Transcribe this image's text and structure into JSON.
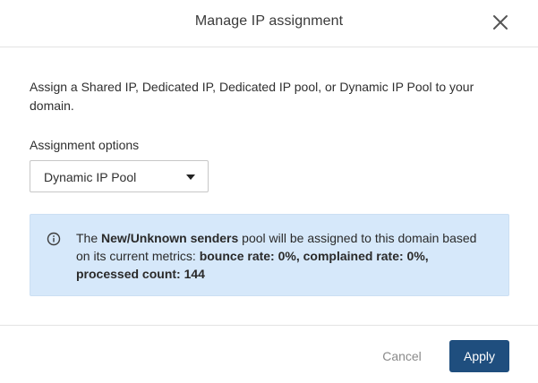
{
  "dialog": {
    "title": "Manage IP assignment",
    "close_icon": "close-icon"
  },
  "body": {
    "description": "Assign a Shared IP, Dedicated IP, Dedicated IP pool, or Dynamic IP Pool to your domain."
  },
  "assignment": {
    "label": "Assignment options",
    "selected_value": "Dynamic IP Pool",
    "caret_icon": "caret-down-icon"
  },
  "info": {
    "icon": "info-icon",
    "text_1": "The ",
    "pool_name": "New/Unknown senders",
    "text_2": " pool will be assigned to this domain based on its current metrics: ",
    "metrics": "bounce rate: 0%, complained rate: 0%, processed count: 144",
    "background_color": "#d6e8fa"
  },
  "footer": {
    "cancel_label": "Cancel",
    "apply_label": "Apply",
    "apply_color": "#1f4e7e"
  }
}
